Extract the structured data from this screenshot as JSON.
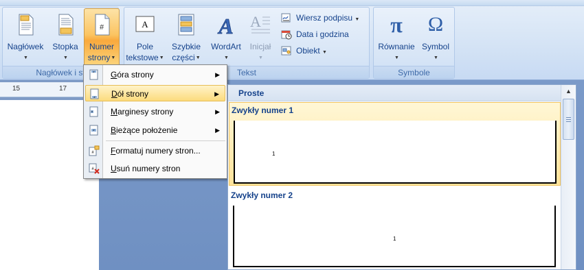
{
  "ribbon": {
    "header_group": {
      "label": "Nagłówek i st",
      "buttons": [
        {
          "line1": "Nagłówek",
          "line2": "",
          "icon": "header-icon"
        },
        {
          "line1": "Stopka",
          "line2": "",
          "icon": "footer-icon"
        },
        {
          "line1": "Numer",
          "line2": "strony",
          "icon": "page-number-icon",
          "active": true
        }
      ]
    },
    "text_group": {
      "label": "Tekst",
      "buttons": [
        {
          "line1": "Pole",
          "line2": "tekstowe",
          "icon": "text-box-icon"
        },
        {
          "line1": "Szybkie",
          "line2": "części",
          "icon": "quick-parts-icon"
        },
        {
          "line1": "WordArt",
          "line2": "",
          "icon": "wordart-icon"
        },
        {
          "line1": "Inicjał",
          "line2": "",
          "icon": "drop-cap-icon",
          "disabled": true
        }
      ],
      "small_buttons": [
        {
          "label": "Wiersz podpisu",
          "icon": "signature-line-icon",
          "has_arrow": true
        },
        {
          "label": "Data i godzina",
          "icon": "date-time-icon",
          "has_arrow": false
        },
        {
          "label": "Obiekt",
          "icon": "object-icon",
          "has_arrow": true
        }
      ]
    },
    "symbols_group": {
      "label": "Symbole",
      "buttons": [
        {
          "line1": "Równanie",
          "line2": "",
          "icon": "pi-icon",
          "glyph": "π"
        },
        {
          "line1": "Symbol",
          "line2": "",
          "icon": "omega-icon",
          "glyph": "Ω"
        }
      ]
    }
  },
  "ruler": {
    "ticks": [
      "15",
      "17"
    ]
  },
  "menu": {
    "items": [
      {
        "label": "Góra strony",
        "underline": "G",
        "rest": "óra strony",
        "icon": "page-top-icon",
        "submenu": true
      },
      {
        "label": "Dół strony",
        "underline": "D",
        "rest": "ół strony",
        "icon": "page-bottom-icon",
        "submenu": true,
        "highlighted": true
      },
      {
        "label": "Marginesy strony",
        "underline": "M",
        "rest": "arginesy strony",
        "icon": "page-margins-icon",
        "submenu": true
      },
      {
        "label": "Bieżące położenie",
        "underline": "B",
        "rest": "ieżące położenie",
        "icon": "current-position-icon",
        "submenu": true
      },
      {
        "label": "Formatuj numery stron...",
        "underline": "F",
        "rest": "ormatuj numery stron...",
        "icon": "format-page-numbers-icon",
        "submenu": false
      },
      {
        "label": "Usuń numery stron",
        "underline": "U",
        "rest": "suń numery stron",
        "icon": "remove-page-numbers-icon",
        "submenu": false
      }
    ]
  },
  "gallery": {
    "section": "Proste",
    "items": [
      {
        "title": "Zwykły numer 1",
        "number": "1",
        "align": "left",
        "selected": true
      },
      {
        "title": "Zwykły numer 2",
        "number": "1",
        "align": "center",
        "selected": false
      }
    ]
  },
  "colors": {
    "ribbon_text": "#15428b",
    "active_button": "#f9a93d",
    "highlight": "#fcdb7d"
  }
}
